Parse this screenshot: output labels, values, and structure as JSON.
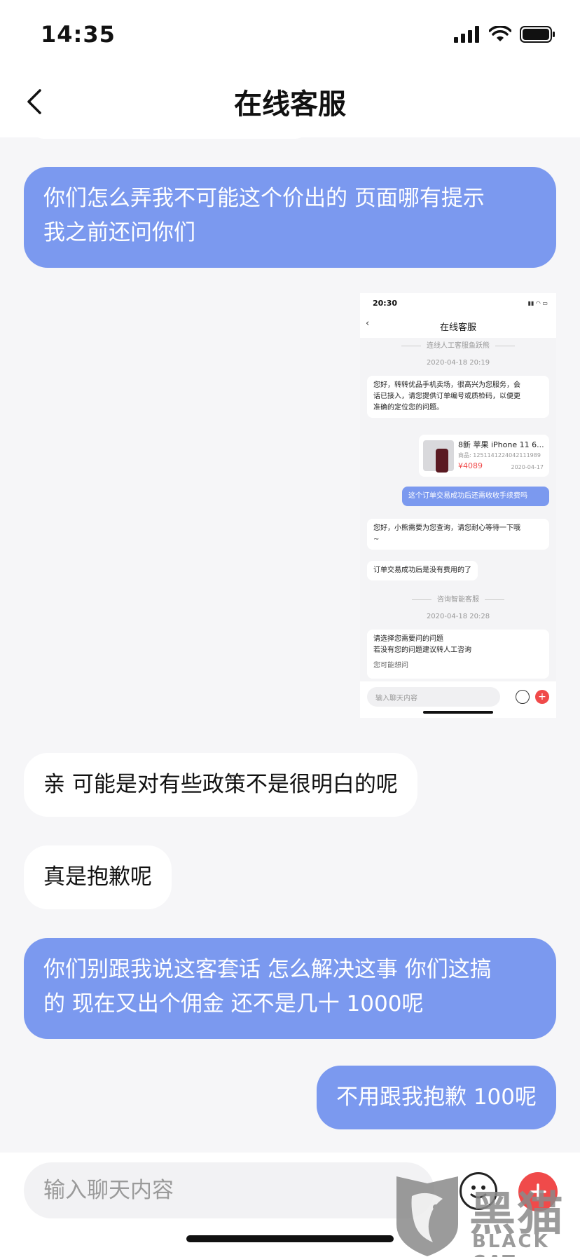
{
  "status_bar": {
    "time": "14:35"
  },
  "header": {
    "title": "在线客服"
  },
  "messages": [
    {
      "side": "right",
      "text_lines": [
        "你们怎么弄我不可能这个价出的 页面哪有提示",
        "我之前还问你们"
      ]
    },
    {
      "side": "right",
      "type": "image"
    },
    {
      "side": "left",
      "text": "亲 可能是对有些政策不是很明白的呢"
    },
    {
      "side": "left",
      "text": "真是抱歉呢"
    },
    {
      "side": "right",
      "text_lines": [
        "你们别跟我说这客套话  怎么解决这事  你们这搞",
        "的 现在又出个佣金 还不是几十  1000呢"
      ]
    },
    {
      "side": "right",
      "text": "不用跟我抱歉  100呢"
    }
  ],
  "embedded_screenshot": {
    "time": "20:30",
    "title": "在线客服",
    "divider1": "连线人工客服鱼跃熊",
    "date1": "2020-04-18 20:19",
    "greeting_lines": [
      "您好，转转优品手机卖场，很高兴为您服务，会",
      "话已接入，请您提供订单编号或质检码，以便更",
      "准确的定位您的问题。"
    ],
    "product": {
      "title": "8新 苹果 iPhone 11 6...",
      "id": "商品: 1251141224042111989",
      "price": "¥4089",
      "date": "2020-04-17"
    },
    "user_msg": "这个订单交易成功后还需收收手续费吗",
    "reply1_lines": [
      "您好，小熊需要为您查询，请您耐心等待一下哦",
      "~"
    ],
    "reply2": "订单交易成功后是没有费用的了",
    "divider2": "咨询智能客服",
    "date2": "2020-04-18 20:28",
    "bot_lines": [
      "请选择您需要问的问题",
      "若没有您的问题建议转人工咨询"
    ],
    "maybe": "您可能想问",
    "input_placeholder": "输入聊天内容"
  },
  "input": {
    "placeholder": "输入聊天内容",
    "value": ""
  },
  "watermark": {
    "cn": "黑猫",
    "en": "BLACK CAT"
  },
  "colors": {
    "outgoing_bubble": "#7b99ef",
    "incoming_bubble": "#ffffff",
    "accent_red": "#f04a4a",
    "background": "#f6f6f8"
  }
}
